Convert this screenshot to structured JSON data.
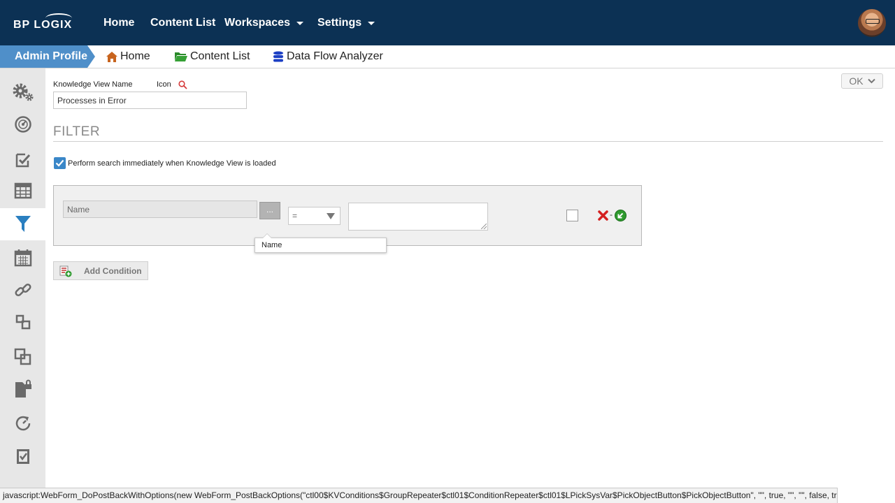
{
  "brand": {
    "logo_text": "BP LOGIX"
  },
  "topnav": {
    "home": "Home",
    "content_list": "Content List",
    "workspaces": "Workspaces",
    "settings": "Settings"
  },
  "breadcrumb": {
    "active": "Admin Profile",
    "home": "Home",
    "content_list": "Content List",
    "data_flow_analyzer": "Data Flow Analyzer"
  },
  "sidebar": {
    "items": [
      {
        "icon": "gears-icon"
      },
      {
        "icon": "dashboard-icon"
      },
      {
        "icon": "checklist-edit-icon"
      },
      {
        "icon": "table-icon"
      },
      {
        "icon": "filter-icon",
        "active": true
      },
      {
        "icon": "calendar-icon"
      },
      {
        "icon": "link-icon"
      },
      {
        "icon": "relation-icon"
      },
      {
        "icon": "copy-icon"
      },
      {
        "icon": "document-lock-icon"
      },
      {
        "icon": "refresh-gauge-icon"
      },
      {
        "icon": "clipboard-check-icon"
      }
    ]
  },
  "form": {
    "kv_name_label": "Knowledge View Name",
    "icon_label": "Icon",
    "kv_name_value": "Processes in Error",
    "ok_label": "OK"
  },
  "filter": {
    "heading": "FILTER",
    "immediate_search_label": "Perform search immediately when Knowledge View is loaded",
    "immediate_search_checked": true,
    "condition": {
      "field_value": "Name",
      "pick_label": "...",
      "operator": "=",
      "value": "",
      "tooltip": "Name"
    },
    "add_condition_label": "Add Condition"
  },
  "status_bar": "javascript:WebForm_DoPostBackWithOptions(new WebForm_PostBackOptions(\"ctl00$KVConditions$GroupRepeater$ctl01$ConditionRepeater$ctl01$LPickSysVar$PickObjectButton$PickObjectButton\", \"\", true, \"\", \"\", false, true))",
  "colors": {
    "navbar": "#0c3154",
    "crumb_active": "#4f8fc9",
    "sidebar_icon": "#6a6a6a",
    "active_icon": "#2a7fc0",
    "delete": "#d42020",
    "go": "#2e9a2e"
  }
}
